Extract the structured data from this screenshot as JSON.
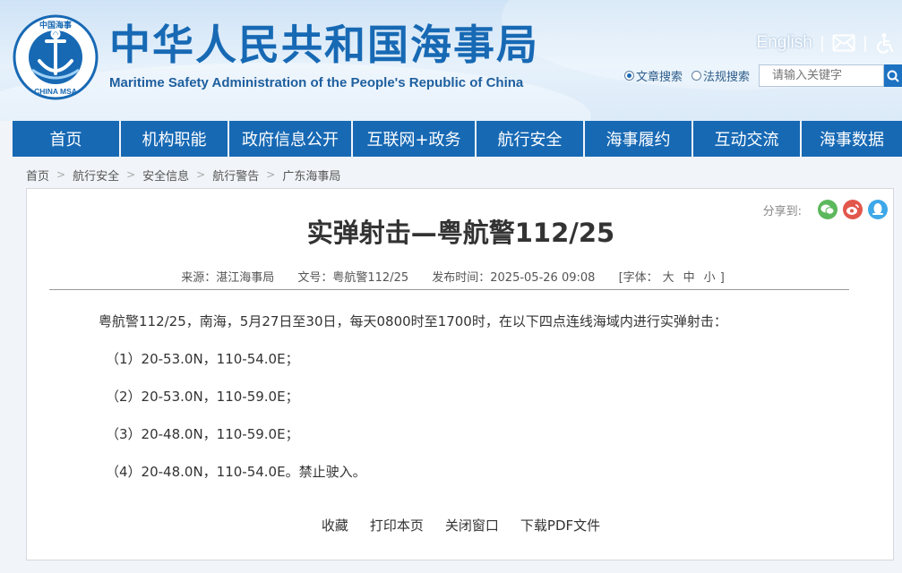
{
  "header": {
    "logo_text_top": "中国海事",
    "logo_text_bottom": "CHINA MSA",
    "title": "中华人民共和国海事局",
    "subtitle": "Maritime Safety Administration of the People's Republic of China",
    "english_link": "English",
    "separator": "|",
    "mail_icon": "mail-icon",
    "accessibility_icon": "accessibility-icon",
    "search": {
      "options": [
        "文章搜索",
        "法规搜索"
      ],
      "selected": "文章搜索",
      "placeholder": "请输入关键字",
      "search_icon": "search-icon"
    }
  },
  "nav": {
    "items": [
      "首页",
      "机构职能",
      "政府信息公开",
      "互联网+政务",
      "航行安全",
      "海事履约",
      "互动交流",
      "海事数据"
    ],
    "color": "#1769b4"
  },
  "breadcrumb": [
    "首页",
    "航行安全",
    "安全信息",
    "航行警告",
    "广东海事局"
  ],
  "article": {
    "share_label": "分享到:",
    "share_icons": [
      "wechat-icon",
      "weibo-icon",
      "qq-icon"
    ],
    "title": "实弹射击—粤航警112/25",
    "meta": {
      "source": "来源：湛江海事局",
      "doc_no": "文号：粤航警112/25",
      "publish_time": "发布时间：2025-05-26 09:08",
      "font_label": "[字体：",
      "font_sizes": [
        "大",
        "中",
        "小"
      ],
      "font_close": "]"
    },
    "paragraphs": [
      "粤航警112/25，南海，5月27日至30日，每天0800时至1700时，在以下四点连线海域内进行实弹射击：",
      "（1）20-53.0N，110-54.0E；",
      "（2）20-53.0N，110-59.0E；",
      "（3）20-48.0N，110-59.0E；",
      "（4）20-48.0N，110-54.0E。禁止驶入。"
    ],
    "actions": [
      "收藏",
      "打印本页",
      "关闭窗口",
      "下载PDF文件"
    ]
  }
}
